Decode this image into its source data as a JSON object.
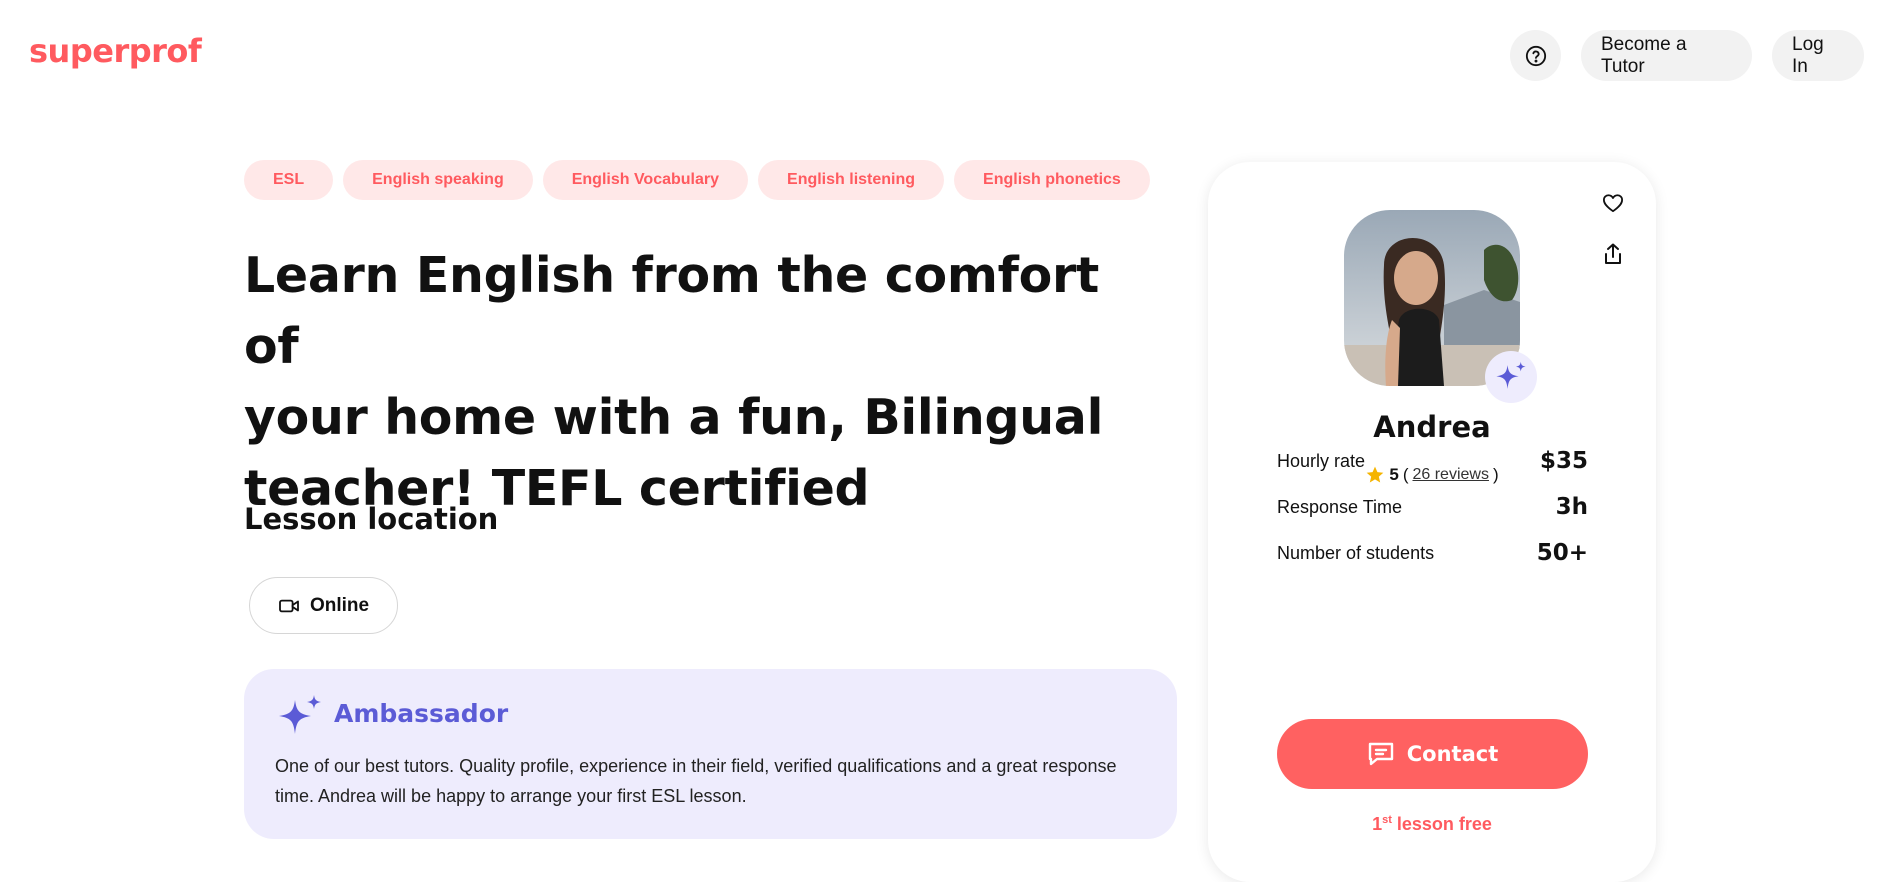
{
  "header": {
    "logo": "superprof",
    "help_icon": "question-circle-icon",
    "become_tutor_label": "Become a Tutor",
    "login_label": "Log In"
  },
  "tags": [
    "ESL",
    "English speaking",
    "English Vocabulary",
    "English listening",
    "English phonetics"
  ],
  "headline": {
    "line1": "Learn English from the comfort of",
    "line2": "your home with a fun, Bilingual",
    "line3": "teacher! TEFL certified"
  },
  "location": {
    "title": "Lesson location",
    "online_icon": "video-camera-icon",
    "online_label": "Online"
  },
  "ambassador": {
    "icon": "sparkle-icon",
    "title": "Ambassador",
    "text": "One of our best tutors. Quality profile, experience in their field, verified qualifications and a great response time. Andrea will be happy to arrange your first ESL lesson."
  },
  "tutor": {
    "name": "Andrea",
    "rating": "5",
    "reviews_link": "26 reviews",
    "stats": [
      {
        "label": "Hourly rate",
        "value": "$35"
      },
      {
        "label": "Response Time",
        "value": "3h"
      },
      {
        "label": "Number of students",
        "value": "50+"
      }
    ],
    "contact_label": "Contact",
    "free_lesson_num": "1",
    "free_lesson_sup": "st",
    "free_lesson_text": " lesson free"
  },
  "colors": {
    "brand": "#ff5a5f",
    "tag_bg": "#ffe8e8",
    "ambassador_bg": "#eeecfd",
    "ambassador_accent": "#5b5bd6",
    "contact_bg": "#ff6161",
    "star": "#f5b400"
  }
}
